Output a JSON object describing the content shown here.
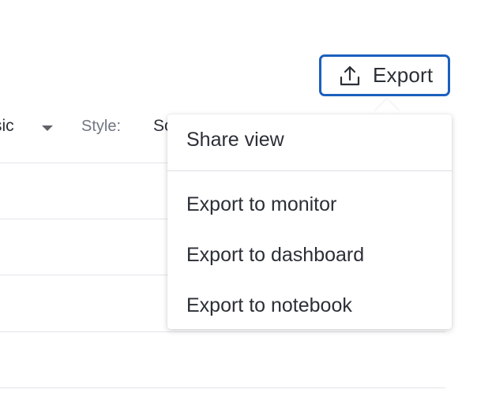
{
  "toolbar": {
    "export_label": "Export",
    "export_icon": "upload-icon",
    "accent_color": "#1c5fbf"
  },
  "filters": {
    "visible_value_fragment": "sic",
    "style_label": "Style:",
    "style_value_fragment": "So"
  },
  "export_menu": {
    "items": [
      {
        "label": "Share view"
      },
      {
        "label": "Export to monitor"
      },
      {
        "label": "Export to dashboard"
      },
      {
        "label": "Export to notebook"
      }
    ]
  }
}
